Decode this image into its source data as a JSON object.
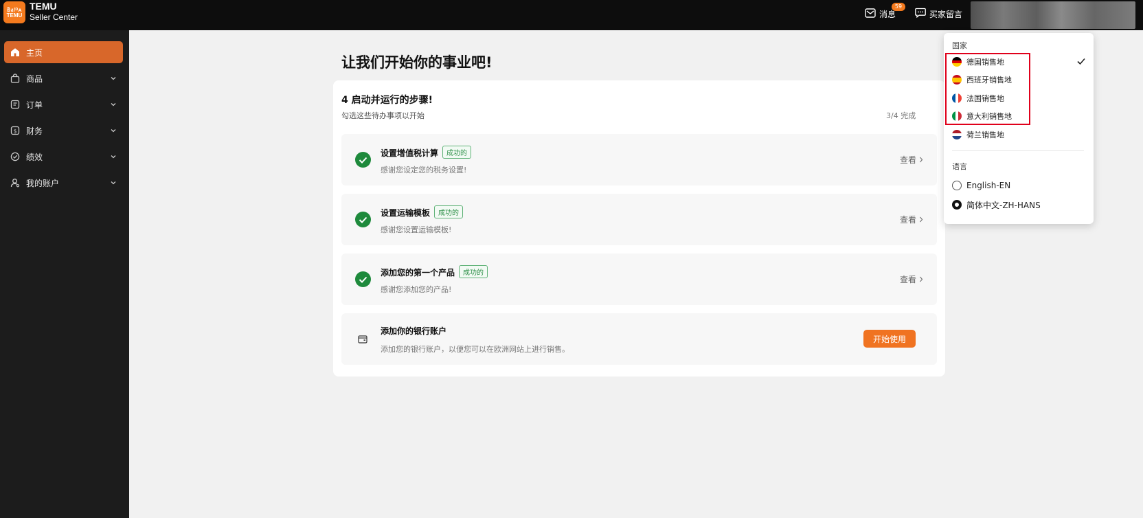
{
  "header": {
    "logo_line1": "ยิง/ᴰᴀ",
    "logo_line2": "TEMU",
    "brand_name": "TEMU",
    "brand_sub": "Seller Center",
    "messages_label": "消息",
    "messages_badge": "59",
    "buyer_messages_label": "买家留言"
  },
  "sidebar": {
    "items": [
      {
        "label": "主页",
        "icon": "home-icon"
      },
      {
        "label": "商品",
        "icon": "bag-icon"
      },
      {
        "label": "订单",
        "icon": "order-icon"
      },
      {
        "label": "财务",
        "icon": "dollar-icon"
      },
      {
        "label": "绩效",
        "icon": "performance-icon"
      },
      {
        "label": "我的账户",
        "icon": "user-icon"
      }
    ]
  },
  "main": {
    "title": "让我们开始你的事业吧!",
    "card_title": "4 启动并运行的步骤!",
    "card_subtitle": "勾选这些待办事项以开始",
    "progress": "3/4 完成",
    "steps": [
      {
        "title": "设置增值税计算",
        "status": "成功的",
        "desc": "感谢您设定您的税务设置!",
        "action": "查看"
      },
      {
        "title": "设置运输模板",
        "status": "成功的",
        "desc": "感谢您设置运输模板!",
        "action": "查看"
      },
      {
        "title": "添加您的第一个产品",
        "status": "成功的",
        "desc": "感谢您添加您的产品!",
        "action": "查看"
      },
      {
        "title": "添加你的银行账户",
        "desc": "添加您的银行账户，以便您可以在欧洲网站上进行销售。",
        "action": "开始使用"
      }
    ]
  },
  "dropdown": {
    "country_header": "国家",
    "countries": [
      {
        "label": "德国销售地",
        "selected": true,
        "colors": [
          "#000000",
          "#dd0000",
          "#ffce00"
        ]
      },
      {
        "label": "西班牙销售地",
        "colors": [
          "#c60b1e",
          "#ffc400",
          "#c60b1e"
        ]
      },
      {
        "label": "法国销售地",
        "colors": [
          "#0055a4",
          "#ffffff",
          "#ef4135"
        ]
      },
      {
        "label": "意大利销售地",
        "colors": [
          "#009246",
          "#ffffff",
          "#ce2b37"
        ]
      },
      {
        "label": "荷兰销售地",
        "colors": [
          "#ae1c28",
          "#ffffff",
          "#21468b"
        ]
      }
    ],
    "language_header": "语言",
    "languages": [
      {
        "label": "English-EN",
        "selected": false
      },
      {
        "label": "简体中文-ZH-HANS",
        "selected": true
      }
    ]
  }
}
